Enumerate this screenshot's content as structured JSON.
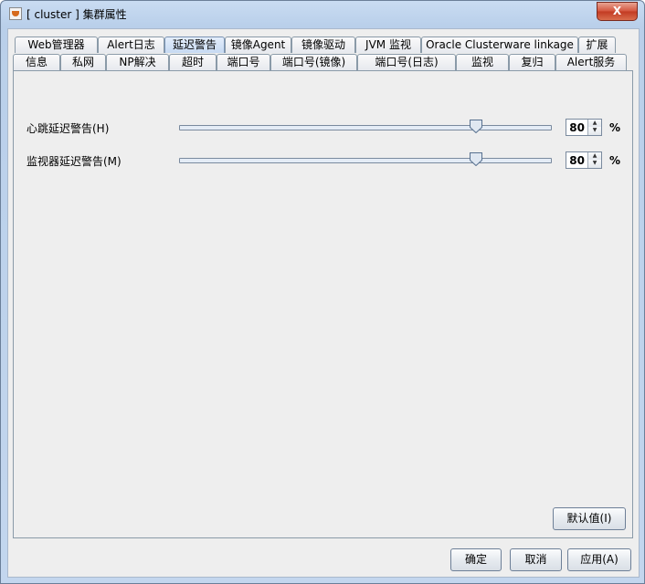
{
  "window": {
    "title": "[ cluster ] 集群属性",
    "close_glyph": "X"
  },
  "tabs_row1": [
    "Web管理器",
    "Alert日志",
    "延迟警告",
    "镜像Agent",
    "镜像驱动",
    "JVM 监视",
    "Oracle Clusterware linkage",
    "扩展"
  ],
  "tabs_row2": [
    "信息",
    "私网",
    "NP解决",
    "超时",
    "端口号",
    "端口号(镜像)",
    "端口号(日志)",
    "监视",
    "复归",
    "Alert服务"
  ],
  "selected_tab": "延迟警告",
  "delay_warning": {
    "heartbeat": {
      "label": "心跳延迟警告(H)",
      "value": "80",
      "unit": "%",
      "slider_fraction": 0.8
    },
    "monitor": {
      "label": "监视器延迟警告(M)",
      "value": "80",
      "unit": "%",
      "slider_fraction": 0.8
    }
  },
  "buttons": {
    "default": "默认值(I)",
    "ok": "确定",
    "cancel": "取消",
    "apply": "应用(A)"
  }
}
